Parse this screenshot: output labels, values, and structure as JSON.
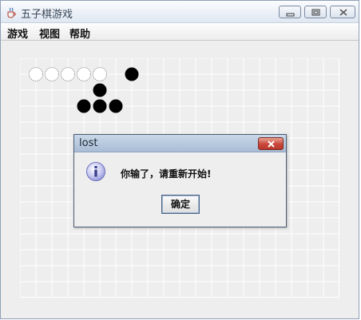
{
  "window": {
    "title": "五子棋游戏",
    "controls": [
      "minimize-icon",
      "maximize-icon",
      "close-icon"
    ]
  },
  "menu": {
    "game": "游戏",
    "view": "视图",
    "help": "帮助"
  },
  "board": {
    "lines": 20,
    "line_color": "#ffffff",
    "background": "#eeeeee",
    "white_stones": [
      [
        0,
        0
      ],
      [
        1,
        0
      ],
      [
        2,
        0
      ],
      [
        3,
        0
      ],
      [
        4,
        0
      ]
    ],
    "black_stones": [
      [
        6,
        0
      ],
      [
        4,
        1
      ],
      [
        3,
        2
      ],
      [
        4,
        2
      ],
      [
        5,
        2
      ]
    ],
    "white_color": "#ffffff",
    "black_color": "#000000"
  },
  "dialog": {
    "title": "lost",
    "icon": "info-icon",
    "message": "你输了，请重新开始!",
    "ok_label": "确定"
  }
}
